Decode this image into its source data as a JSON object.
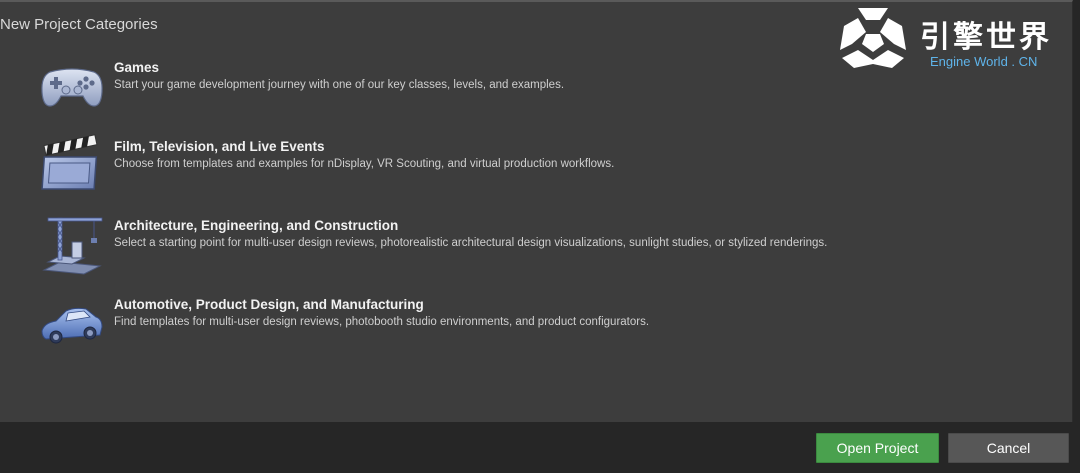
{
  "panel": {
    "title": "New Project Categories"
  },
  "categories": [
    {
      "title": "Games",
      "description": "Start your game development journey with one of our key classes, levels, and examples.",
      "icon": "gamepad-icon"
    },
    {
      "title": "Film, Television, and Live Events",
      "description": "Choose from templates and examples for nDisplay, VR Scouting, and virtual production workflows.",
      "icon": "clapperboard-icon"
    },
    {
      "title": "Architecture, Engineering, and Construction",
      "description": "Select a starting point for multi-user design reviews, photorealistic architectural design visualizations, sunlight studies, or stylized renderings.",
      "icon": "crane-icon"
    },
    {
      "title": "Automotive, Product Design, and Manufacturing",
      "description": "Find templates for multi-user design reviews, photobooth studio environments, and product configurators.",
      "icon": "car-icon"
    }
  ],
  "watermark": {
    "cn_text": "引擎世界",
    "en_text": "Engine World . CN",
    "icon": "engine-world-logo-icon"
  },
  "footer": {
    "open_label": "Open Project",
    "cancel_label": "Cancel"
  },
  "colors": {
    "panel_bg": "#3d3d3d",
    "window_bg": "#262626",
    "open_button": "#4aa14e",
    "cancel_button": "#575757",
    "accent_blue": "#5fb4ea"
  }
}
